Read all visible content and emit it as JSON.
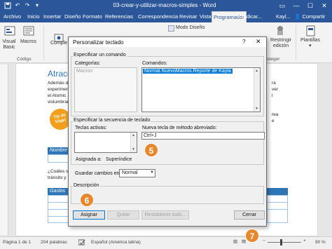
{
  "titlebar": {
    "title": "03-crear-y-utilizar-macros-simples - Word",
    "save_icon": "save-icon",
    "undo_icon": "undo-icon",
    "redo_icon": "redo-icon",
    "customize_icon": "customize-icon",
    "restore_icon": "ribbon-display-icon",
    "minimize": "—",
    "maximize": "☐",
    "close": "✕"
  },
  "tabs": [
    {
      "label": "Archivo"
    },
    {
      "label": "Inicio"
    },
    {
      "label": "Insertar"
    },
    {
      "label": "Diseño"
    },
    {
      "label": "Formato"
    },
    {
      "label": "Referencias"
    },
    {
      "label": "Correspondencia"
    },
    {
      "label": "Revisar"
    },
    {
      "label": "Vista"
    },
    {
      "label": "Programador"
    }
  ],
  "tell_me": "Indicar...",
  "user": "Kayl...",
  "share": "Compartir",
  "ribbon": {
    "visual_basic": "Visual Basic",
    "macros": "Macros",
    "complementos": "Comple",
    "modo_diseno": "Modo Diseño",
    "restringir": "Restringir edición",
    "plantillas": "Plantillas",
    "group_codigo": "Código",
    "group_proteger": "oteger"
  },
  "document": {
    "title": "Atracci",
    "lines": [
      "Además d",
      "experimen",
      "el Atomic",
      "vislumbrar",
      "¿Cuáles sc",
      "tránsito y"
    ],
    "right_lines": [
      "ra",
      "ver",
      "l",
      "rea",
      "e"
    ],
    "tip": "Tip de Viaje!",
    "table1_header": "Nombre",
    "table2_header": "Gastos"
  },
  "dialog": {
    "title": "Personalizar teclado",
    "help": "?",
    "close": "✕",
    "specify_command": "Especificar un comando",
    "categories_label": "Categorías:",
    "categories": [
      "Macros"
    ],
    "commands_label": "Comandos:",
    "commands": [
      "Normal.NuevoMacros.Reporte de Kayla"
    ],
    "specify_keys": "Especificar la secuencia de teclado",
    "current_keys_label": "Teclas activas:",
    "new_key_label": "Nueva tecla de método abreviado:",
    "new_key_value": "Ctrl+J",
    "assigned_label": "Asignada a:",
    "assigned_value": "Superíndice",
    "save_in_label": "Guardar cambios en:",
    "save_in_value": "Normal",
    "description_label": "Descripción",
    "buttons": {
      "assign": "Asignar",
      "remove": "Quitar",
      "reset": "Restablecer todo...",
      "close": "Cerrar"
    }
  },
  "callouts": [
    "5",
    "6",
    "7"
  ],
  "status": {
    "page": "Página 1 de 1",
    "words": "204 palabras",
    "language": "Español (América latina)",
    "zoom": "90 %",
    "zoom_minus": "−",
    "zoom_plus": "+"
  },
  "colors": {
    "word_blue": "#2b579a",
    "selection": "#0078d7",
    "callout": "#e8872b",
    "heading": "#2e75b6"
  }
}
